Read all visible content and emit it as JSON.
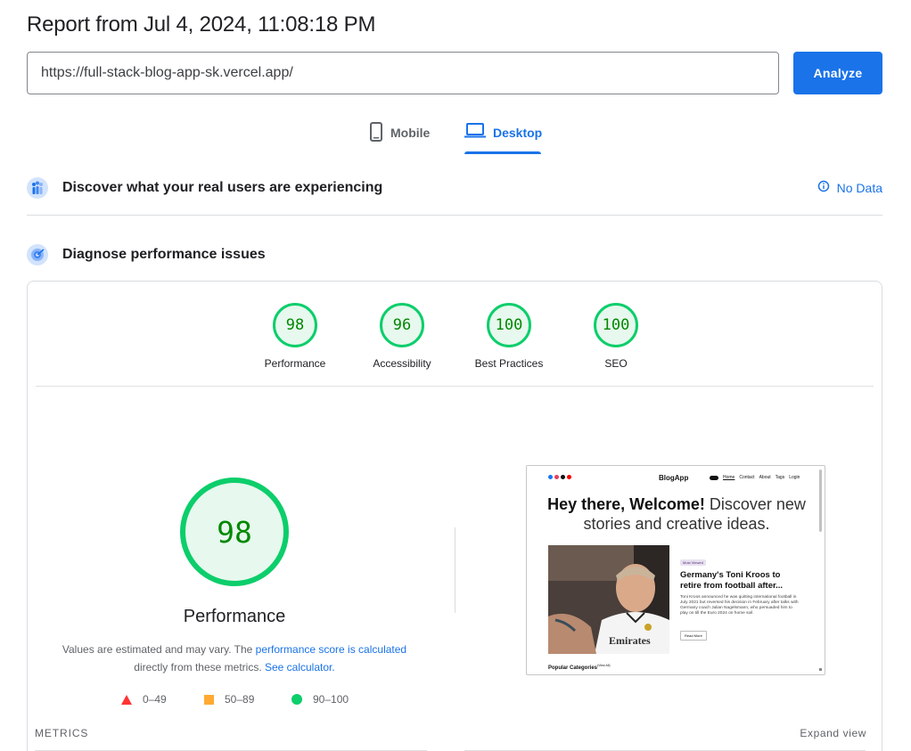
{
  "report": {
    "title": "Report from Jul 4, 2024, 11:08:18 PM"
  },
  "url_bar": {
    "value": "https://full-stack-blog-app-sk.vercel.app/",
    "analyze_label": "Analyze"
  },
  "device_tabs": [
    {
      "label": "Mobile",
      "icon": "phone-icon",
      "selected": false
    },
    {
      "label": "Desktop",
      "icon": "laptop-icon",
      "selected": true
    }
  ],
  "crux": {
    "title": "Discover what your real users are experiencing",
    "status": "No Data",
    "icon": "crux-users-icon"
  },
  "diagnose": {
    "title": "Diagnose performance issues",
    "icon": "lighthouse-icon"
  },
  "categories": [
    {
      "label": "Performance",
      "score": "98"
    },
    {
      "label": "Accessibility",
      "score": "96"
    },
    {
      "label": "Best Practices",
      "score": "100"
    },
    {
      "label": "SEO",
      "score": "100"
    }
  ],
  "main_gauge": {
    "score": "98",
    "label": "Performance",
    "score_fraction": 0.98
  },
  "explanation": {
    "text_1": "Values are estimated and may vary. The ",
    "link_1": "performance score is calculated",
    "text_2": " directly from these metrics. ",
    "link_2": "See calculator.",
    "text_3": ""
  },
  "legend": [
    {
      "range": "0–49",
      "shape": "triangle",
      "color": "#ff3333"
    },
    {
      "range": "50–89",
      "shape": "square",
      "color": "#ffaa33"
    },
    {
      "range": "90–100",
      "shape": "circle",
      "color": "#0cce6b"
    }
  ],
  "screenshot": {
    "brand": "BlogApp",
    "nav": [
      "Home",
      "Contact",
      "About",
      "Tags",
      "Login"
    ],
    "hero_bold": "Hey there, Welcome!",
    "hero_rest": " Discover new stories and creative ideas.",
    "pill": "Most Viewed",
    "post_title": "Germany's Toni Kroos to retire from football after...",
    "post_desc": "Toni Kroos announced he was quitting international football in July 2021 but reversed his decision in February after talks with Germany coach Julian Nagelsmann, who persuaded him to play on till the Euro 2024 on home soil.",
    "read_more": "Read More",
    "popular": "Popular Categories",
    "popular_sup": "(View All)",
    "jersey_text": "Emirates"
  },
  "metrics": {
    "label": "METRICS",
    "expand": "Expand view"
  },
  "colors": {
    "accent": "#1a73e8",
    "pass": "#0cce6b",
    "pass_text": "#008800",
    "pass_bg": "#e7f8ee"
  }
}
